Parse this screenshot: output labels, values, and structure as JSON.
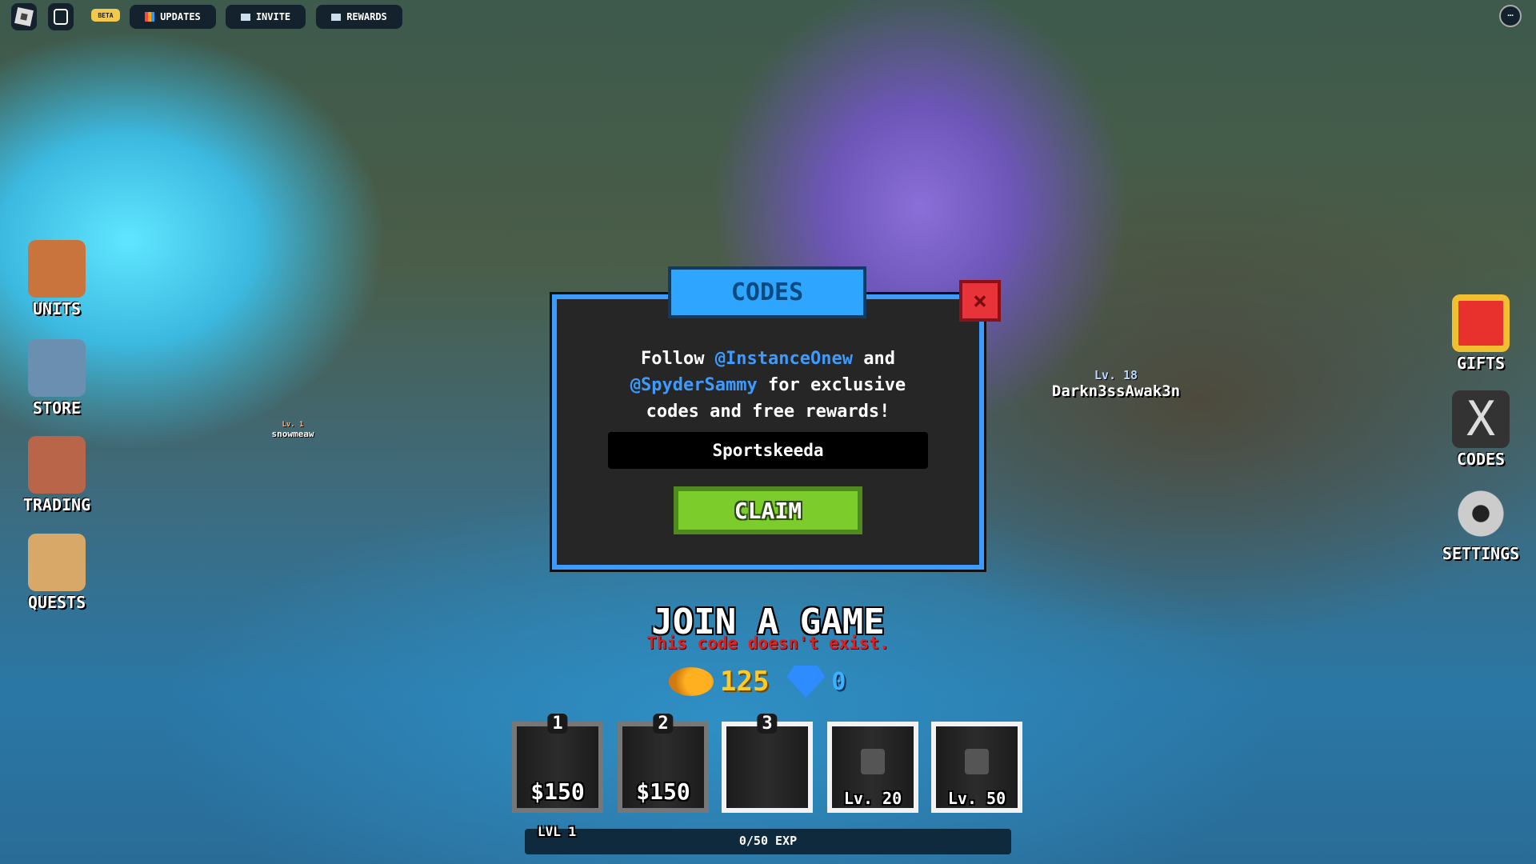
{
  "topbar": {
    "beta": "BETA",
    "updates": "UPDATES",
    "invite": "INVITE",
    "rewards": "REWARDS"
  },
  "left_menu": [
    {
      "label": "UNITS",
      "icon": "backpack-icon"
    },
    {
      "label": "STORE",
      "icon": "cart-icon"
    },
    {
      "label": "TRADING",
      "icon": "trade-box-icon"
    },
    {
      "label": "QUESTS",
      "icon": "scroll-icon"
    }
  ],
  "right_menu": [
    {
      "label": "GIFTS",
      "icon": "gift-icon"
    },
    {
      "label": "CODES",
      "icon": "x-logo-icon"
    },
    {
      "label": "SETTINGS",
      "icon": "gear-icon"
    }
  ],
  "players": [
    {
      "level": "Lv. 18",
      "name": "Darkn3ssAwak3n"
    },
    {
      "level": "Lv. 1",
      "name": "snowmeaw"
    }
  ],
  "modal": {
    "title": "CODES",
    "line1_a": "Follow ",
    "handle1": "@InstanceOnew",
    "line1_b": " and",
    "handle2": "@SpyderSammy",
    "line2_b": " for exclusive",
    "line3": "codes and free rewards!",
    "input_value": "Sportskeeda",
    "claim": "CLAIM",
    "close": "×"
  },
  "join": {
    "title": "JOIN A GAME",
    "error": "This code doesn't exist."
  },
  "currency": {
    "coins": "125",
    "gems": "0"
  },
  "slots": [
    {
      "num": "1",
      "price": "$150"
    },
    {
      "num": "2",
      "price": "$150"
    },
    {
      "num": "3"
    },
    {
      "lock": "Lv. 20"
    },
    {
      "lock": "Lv. 50"
    }
  ],
  "exp": {
    "level": "LVL 1",
    "text": "0/50 EXP",
    "progress": 0
  },
  "colors": {
    "accent_blue": "#2ea6ff",
    "handle_blue": "#3d9bff",
    "claim_green": "#7ccc2c",
    "close_red": "#e8333a",
    "error_red": "#e02020",
    "coin_yellow": "#ffc928"
  }
}
